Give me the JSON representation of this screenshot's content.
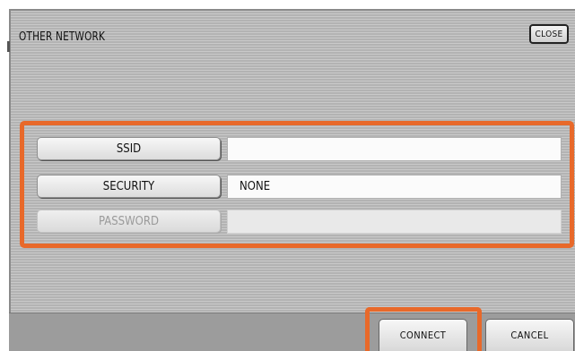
{
  "window": {
    "title": "OTHER NETWORK",
    "close_label": "CLOSE"
  },
  "form": {
    "ssid_label": "SSID",
    "ssid_value": "",
    "security_label": "SECURITY",
    "security_value": "NONE",
    "password_label": "PASSWORD",
    "password_value": ""
  },
  "footer": {
    "connect_label": "CONNECT",
    "cancel_label": "CANCEL"
  },
  "colors": {
    "highlight": "#e8692a",
    "panel": "#bcbcbc"
  }
}
